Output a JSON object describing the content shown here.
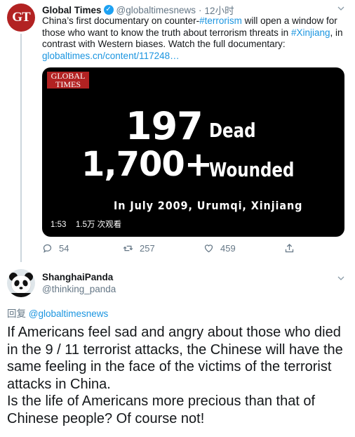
{
  "parent_tweet": {
    "avatar_text": "GT",
    "display_name": "Global Times",
    "verified_mark": "✓",
    "handle": "@globaltimesnews",
    "separator": "·",
    "time": "12小时",
    "text_parts": [
      "China’s first documentary on counter-",
      "#terrorism",
      " will open a window for those who want to know the truth about terrorism threats in ",
      "#Xinjiang",
      ", in contrast with Western biases. Watch the full documentary: ",
      "globaltimes.cn/content/117248…"
    ],
    "video": {
      "logo_line1": "GLOBAL",
      "logo_line2": "TIMES",
      "number1": "197",
      "label1": "Dead",
      "number2": "1,700+",
      "label2": "Wounded",
      "subtitle": "In July 2009, Urumqi, Xinjiang",
      "duration": "1:53",
      "views": "1.5万 次观看"
    },
    "actions": {
      "replies": "54",
      "retweets": "257",
      "likes": "459"
    }
  },
  "reply_tweet": {
    "display_name": "ShanghaiPanda",
    "handle": "@thinking_panda",
    "replying_to_prefix": "回复 ",
    "replying_to_handle": "@globaltimesnews",
    "text_line1": "If Americans feel sad and angry about those who died in the 9 / 11 terrorist attacks, the Chinese will have the same feeling in the face of the victims of the terrorist attacks in China.",
    "text_line2": "Is the life of Americans more precious than that of Chinese people? Of course not!"
  },
  "colors": {
    "link": "#1b95e0",
    "muted": "#657786",
    "verified": "#1da1f2",
    "gt_brand": "#b22222"
  },
  "icons": [
    "gt-logo-avatar",
    "verified-icon",
    "chevron-down-icon",
    "reply-icon",
    "retweet-icon",
    "like-icon",
    "share-icon",
    "panda-avatar"
  ]
}
